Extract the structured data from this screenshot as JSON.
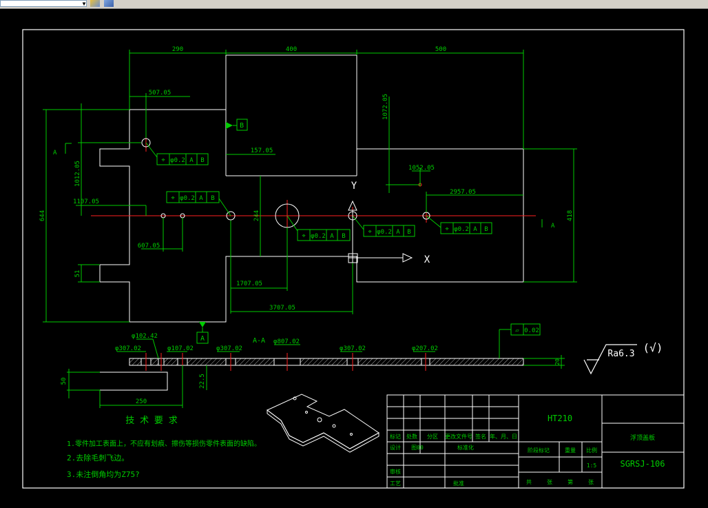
{
  "toolbar": {
    "layer_combo_value": ""
  },
  "dims": {
    "d290": "290",
    "d400": "400",
    "d500": "500",
    "d507": "507.05",
    "d1072": "1072.05",
    "d1012": "1012.05",
    "d157": "157.05",
    "d1052": "1052.05",
    "d2957": "2957.05",
    "d1107": "1107.05",
    "d607": "607.05",
    "d244": "244",
    "d1707": "1707.05",
    "d3707": "3707.05",
    "d644": "644",
    "d418": "418",
    "d51": "51",
    "d50": "50",
    "d22": "22.5",
    "d250": "250",
    "d20": "20"
  },
  "tolerances": {
    "t1": [
      "⌖",
      "φ0.2",
      "A",
      "B"
    ],
    "t2": [
      "⌖",
      "φ0.2",
      "A",
      "B"
    ],
    "t3": [
      "⌖",
      "φ0.2",
      "A",
      "B"
    ],
    "t4": [
      "⌖",
      "φ0.2",
      "A",
      "B"
    ],
    "t5": [
      "⌖",
      "φ0.2",
      "A",
      "B"
    ],
    "flatness": [
      "▱",
      "0.02"
    ]
  },
  "datums": {
    "a": "A",
    "b": "B"
  },
  "axis": {
    "x": "X",
    "y": "Y"
  },
  "section": {
    "label_left": "A",
    "label_right": "A",
    "title": "A-A",
    "holes": [
      "φ307.02",
      "φ102.42",
      "φ107.02",
      "φ307.02",
      "φ807.02",
      "φ307.02",
      "φ207.02"
    ]
  },
  "roughness": {
    "label": "Ra6.3",
    "extra": "(√)"
  },
  "tech_req": {
    "title": "技 术 要 求",
    "items": [
      "1.零件加工表面上，不应有划痕、擦伤等损伤零件表面的缺陷。",
      "2.去除毛刺飞边。",
      "3.未注倒角均为Z75?"
    ]
  },
  "title_block": {
    "material": "HT210",
    "part_name": "浮顶盖板",
    "drawing_no": "SGRSJ-106",
    "scale": "1:5",
    "row1": [
      "标记",
      "处数",
      "分区",
      "更改文件号",
      "签名",
      "年、月、日"
    ],
    "row2": [
      "设计",
      "图00",
      "",
      "标准化",
      "",
      ""
    ],
    "stage_header": [
      "阶段标记",
      "重量",
      "比例"
    ],
    "row_review": "审核",
    "row_process": "工艺",
    "approve": "批准",
    "sheets": [
      "共",
      "张",
      "第",
      "张"
    ]
  }
}
